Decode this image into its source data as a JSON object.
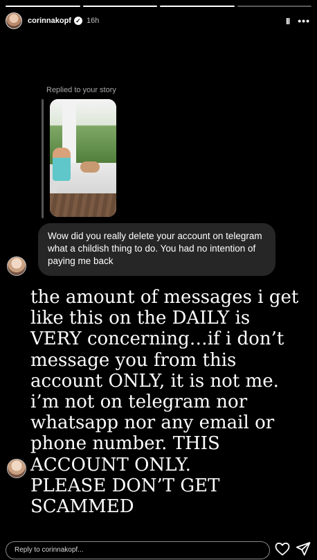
{
  "header": {
    "username": "corinnakopf",
    "verified_mark": "✓",
    "time": "16h",
    "pause_glyph": "II",
    "more_glyph": "•••"
  },
  "progress": {
    "segments": 4,
    "completed": 3
  },
  "story_reply": {
    "label": "Replied to your story",
    "message": "Wow did you really delete your account on telegram what a childish thing to do. You had no intention of paying me back"
  },
  "caption": {
    "text": "the amount of messages i get\nlike this on the DAILY is\nVERY concerning…if i don’t\nmessage you from this\naccount ONLY, it is not me.\ni’m not on telegram nor\nwhatsapp nor any email or\nphone number. THIS\nACCOUNT ONLY.\nPLEASE DON’T GET\nSCAMMED"
  },
  "reply": {
    "placeholder": "Reply to corinnakopf..."
  },
  "icons": {
    "pause": "pause-icon",
    "more": "more-icon",
    "heart": "heart-icon",
    "send": "send-icon"
  },
  "colors": {
    "background": "#000000",
    "bubble": "#262626",
    "muted_text": "#a8a8a8"
  }
}
